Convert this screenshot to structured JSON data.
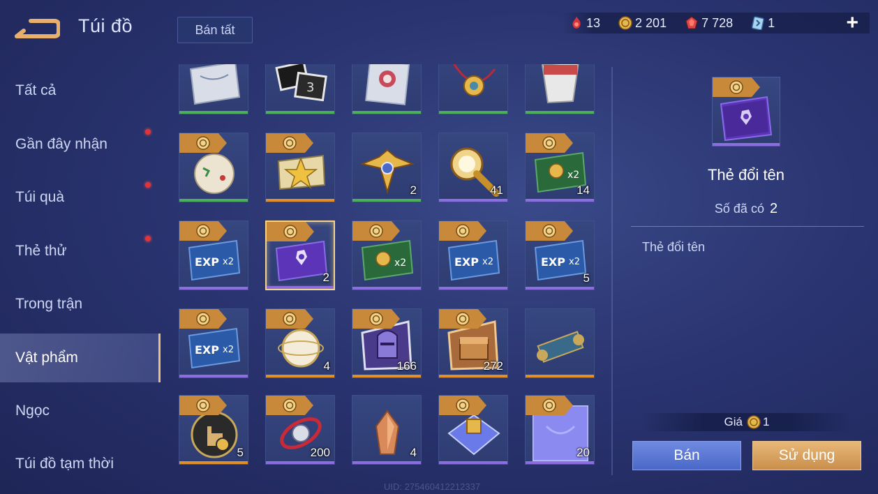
{
  "header": {
    "title": "Túi đồ",
    "sell_all_label": "Bán tất",
    "currencies": [
      {
        "icon": "ruby-flame-icon",
        "value": "13"
      },
      {
        "icon": "gold-coin-icon",
        "value": "2 201"
      },
      {
        "icon": "red-gem-icon",
        "value": "7 728"
      },
      {
        "icon": "voucher-card-icon",
        "value": "1"
      }
    ],
    "plus_label": "+"
  },
  "sidebar": {
    "items": [
      {
        "label": "Tất cả",
        "dot": false,
        "active": false
      },
      {
        "label": "Gần đây nhận",
        "dot": true,
        "active": false
      },
      {
        "label": "Túi quà",
        "dot": true,
        "active": false
      },
      {
        "label": "Thẻ thử",
        "dot": true,
        "active": false
      },
      {
        "label": "Trong trận",
        "dot": false,
        "active": false
      },
      {
        "label": "Vật phẩm",
        "dot": false,
        "active": true
      },
      {
        "label": "Ngọc",
        "dot": false,
        "active": false
      },
      {
        "label": "Túi đồ tạm thời",
        "dot": false,
        "active": false
      }
    ]
  },
  "grid": {
    "rows": [
      [
        {
          "icon": "map-scroll-icon",
          "count": "",
          "bar": "green",
          "tag": false
        },
        {
          "icon": "photo-cards-icon",
          "count": "",
          "bar": "green",
          "tag": false
        },
        {
          "icon": "painted-card-icon",
          "count": "",
          "bar": "green",
          "tag": false
        },
        {
          "icon": "amulet-necklace-icon",
          "count": "",
          "bar": "green",
          "tag": false
        },
        {
          "icon": "paper-cup-icon",
          "count": "",
          "bar": "green",
          "tag": false
        }
      ],
      [
        {
          "icon": "ornament-ball-icon",
          "count": "",
          "bar": "green",
          "tag": true
        },
        {
          "icon": "star-ticket-icon",
          "count": "",
          "bar": "orange",
          "tag": true
        },
        {
          "icon": "winged-emblem-icon",
          "count": "2",
          "bar": "green",
          "tag": false
        },
        {
          "icon": "golden-horn-icon",
          "count": "41",
          "bar": "purple",
          "tag": false
        },
        {
          "icon": "gold-x2-card-icon",
          "count": "14",
          "bar": "purple",
          "tag": true
        }
      ],
      [
        {
          "icon": "exp-x2-card-icon",
          "count": "",
          "bar": "purple",
          "tag": true
        },
        {
          "icon": "rename-card-icon",
          "count": "2",
          "bar": "purple",
          "tag": true,
          "selected": true
        },
        {
          "icon": "gold-x2-card-icon",
          "count": "",
          "bar": "purple",
          "tag": true
        },
        {
          "icon": "exp-x2-card-icon",
          "count": "",
          "bar": "purple",
          "tag": true
        },
        {
          "icon": "exp-x2-card-icon",
          "count": "5",
          "bar": "purple",
          "tag": true
        }
      ],
      [
        {
          "icon": "exp-x2-card-icon",
          "count": "",
          "bar": "purple",
          "tag": true
        },
        {
          "icon": "pearl-orb-icon",
          "count": "4",
          "bar": "orange",
          "tag": true
        },
        {
          "icon": "knight-helmet-icon",
          "count": "166",
          "bar": "orange",
          "tag": true
        },
        {
          "icon": "treasure-chest-icon",
          "count": "272",
          "bar": "orange",
          "tag": true
        },
        {
          "icon": "ancient-scroll-icon",
          "count": "",
          "bar": "orange",
          "tag": false
        }
      ],
      [
        {
          "icon": "hand-check-badge-icon",
          "count": "5",
          "bar": "orange",
          "tag": true
        },
        {
          "icon": "ring-orb-icon",
          "count": "200",
          "bar": "purple",
          "tag": true
        },
        {
          "icon": "copper-crystal-icon",
          "count": "4",
          "bar": "purple",
          "tag": false
        },
        {
          "icon": "crystal-frame-icon",
          "count": "",
          "bar": "purple",
          "tag": true
        },
        {
          "icon": "violet-frame-icon",
          "count": "20",
          "bar": "purple",
          "tag": true
        }
      ]
    ]
  },
  "detail": {
    "icon": "rename-card-icon",
    "name": "Thẻ đổi tên",
    "owned_label": "Số đã có",
    "owned_value": "2",
    "description": "Thẻ đổi tên",
    "price_label": "Giá",
    "price_value": "1",
    "sell_label": "Bán",
    "use_label": "Sử dụng"
  },
  "footer": {
    "uid": "UID: 275460412212337"
  },
  "colors": {
    "bar_green": "#4caf5a",
    "bar_orange": "#e0902a",
    "bar_purple": "#8c6ee0",
    "tag_gold": "#c88a3a",
    "dot_red": "#e0343a"
  }
}
